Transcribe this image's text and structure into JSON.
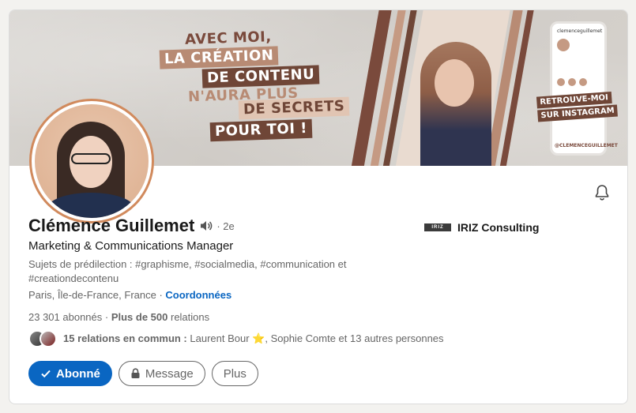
{
  "banner": {
    "slogan": [
      "AVEC MOI,",
      "LA CRÉATION",
      "DE CONTENU",
      "N'AURA PLUS",
      "DE SECRETS",
      "POUR TOI !"
    ],
    "phone_handle": "clemenceguillemet",
    "retrouve": [
      "RETROUVE-MOI",
      "SUR INSTAGRAM"
    ],
    "insta_handle": "@CLEMENCEGUILLEMET",
    "colors": {
      "dark": "#6f4637",
      "mid": "#b88b74",
      "light": "#e1c5b3"
    }
  },
  "profile": {
    "name": "Clémence Guillemet",
    "degree": "· 2e",
    "headline": "Marketing & Communications Manager",
    "topics": "Sujets de prédilection : #graphisme, #socialmedia, #communication et #creationdecontenu",
    "location": "Paris, Île-de-France, France",
    "location_sep": " · ",
    "contact_label": "Coordonnées",
    "followers": "23 301 abonnés",
    "stats_sep": " · ",
    "connections": "Plus de 500",
    "connections_suffix": " relations",
    "mutual_bold": "15 relations en commun :",
    "mutual_first": " Laurent Bour ",
    "mutual_star": "⭐",
    "mutual_rest": ", Sophie Comte et 13 autres personnes"
  },
  "company": {
    "logo_text": "IRIZ",
    "name": "IRIZ Consulting"
  },
  "actions": {
    "follow_label": "Abonné",
    "message_label": "Message",
    "more_label": "Plus"
  },
  "icons": {
    "bell": "bell-icon",
    "speaker": "speaker-icon",
    "check": "check-icon",
    "lock": "lock-icon"
  },
  "colors": {
    "primary": "#0a66c2",
    "text": "#191919",
    "muted": "#666666"
  }
}
